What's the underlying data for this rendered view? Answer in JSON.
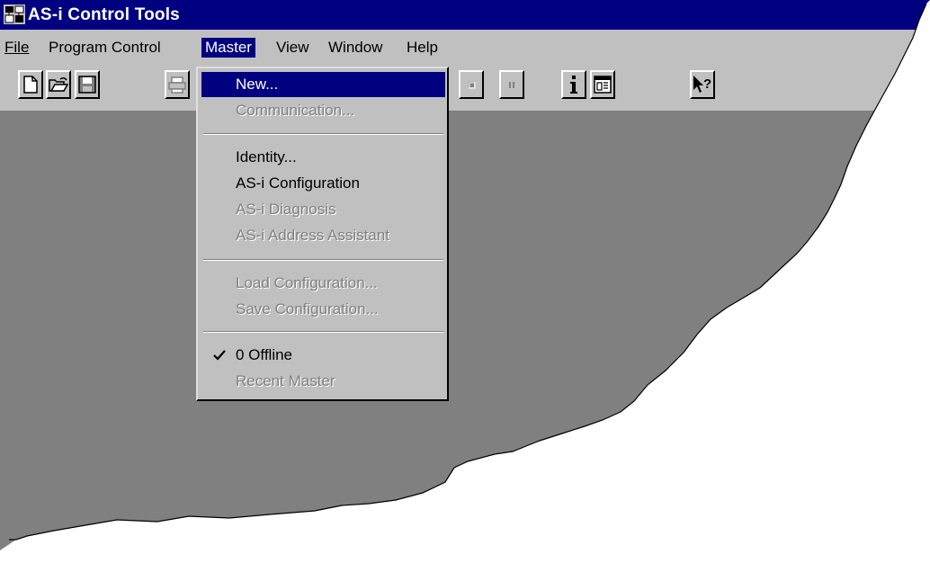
{
  "window": {
    "title": "AS-i Control Tools",
    "icon": "as-i-app-icon"
  },
  "menubar": {
    "items": [
      {
        "label": "File"
      },
      {
        "label": "Program Control"
      },
      {
        "label": "Master",
        "active": true
      },
      {
        "label": "View"
      },
      {
        "label": "Window"
      },
      {
        "label": "Help"
      }
    ]
  },
  "toolbar": {
    "buttons": [
      {
        "icon": "new-document-icon"
      },
      {
        "icon": "open-folder-icon"
      },
      {
        "icon": "save-disk-icon"
      },
      {
        "icon": "print-icon"
      },
      {
        "icon": "stop-icon"
      },
      {
        "icon": "pause-icon"
      },
      {
        "icon": "info-icon"
      },
      {
        "icon": "window-view-icon"
      },
      {
        "icon": "context-help-icon"
      }
    ]
  },
  "master_menu": {
    "items": [
      {
        "label": "New...",
        "state": "highlighted"
      },
      {
        "label": "Communication...",
        "state": "disabled"
      },
      {
        "label": "Identity...",
        "state": "enabled"
      },
      {
        "label": "AS-i Configuration",
        "state": "enabled"
      },
      {
        "label": "AS-i Diagnosis",
        "state": "disabled"
      },
      {
        "label": "AS-i Address Assistant",
        "state": "disabled"
      },
      {
        "label": "Load Configuration...",
        "state": "disabled"
      },
      {
        "label": "Save Configuration...",
        "state": "disabled"
      },
      {
        "label": "0 Offline",
        "state": "checked"
      },
      {
        "label": "Recent Master",
        "state": "disabled"
      }
    ]
  },
  "colors": {
    "titlebar": "#000080",
    "face": "#c0c0c0",
    "workspace": "#808080",
    "highlight": "#000080",
    "disabled_text": "#808080"
  }
}
